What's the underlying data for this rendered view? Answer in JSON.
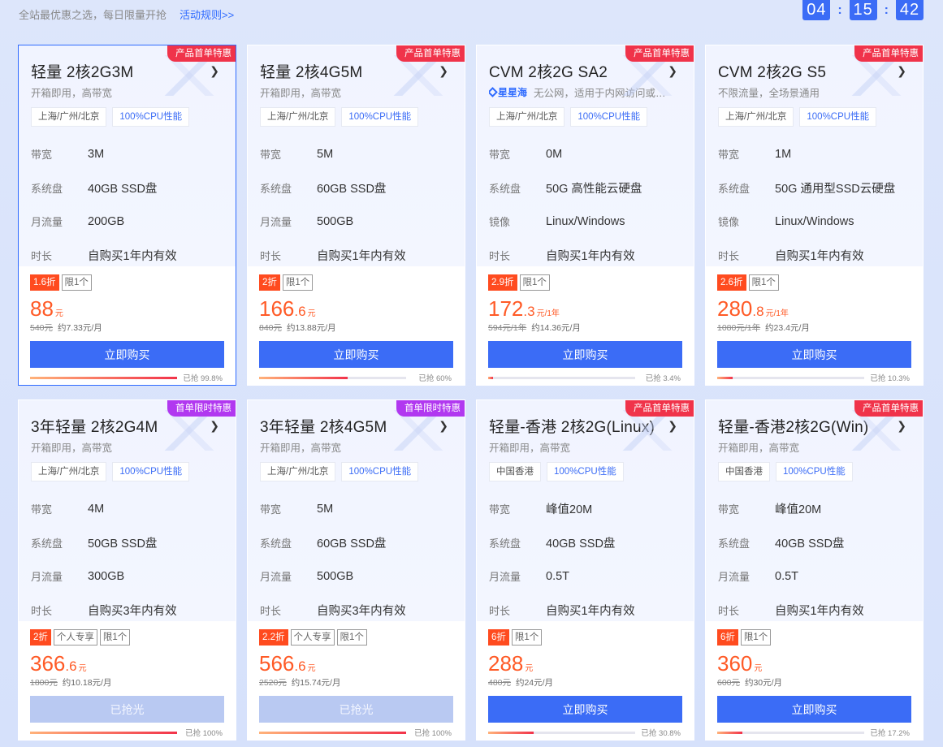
{
  "header": {
    "slogan": "全站最优惠之选，每日限量开抢",
    "rules_link": "活动规则>>",
    "countdown": [
      "04",
      "15",
      "42"
    ],
    "separator": ":"
  },
  "colors": {
    "accent": "#3b6cf6",
    "price": "#ff5a26",
    "ribbon_red": "#f0334a",
    "ribbon_purple": "#b138f0"
  },
  "cards": [
    {
      "ribbon": "产品首单特惠",
      "ribbon_color": "red",
      "active": true,
      "title": "轻量 2核2G3M",
      "subtitle": "开箱即用，高带宽",
      "brand": "",
      "tags": [
        "上海/广州/北京",
        "100%CPU性能"
      ],
      "specs": [
        {
          "k": "带宽",
          "v": "3M"
        },
        {
          "k": "系统盘",
          "v": "40GB SSD盘"
        },
        {
          "k": "月流量",
          "v": "200GB"
        },
        {
          "k": "时长",
          "v": "自购买1年内有效"
        }
      ],
      "badges": [
        "1.6折",
        "限1个"
      ],
      "price_int": "88",
      "price_dec": "",
      "price_unit": "元",
      "orig": "540元",
      "monthly": "约7.33元/月",
      "button": "立即购买",
      "sold_out": false,
      "progress_label": "已抢 99.8%",
      "progress": 0.998
    },
    {
      "ribbon": "产品首单特惠",
      "ribbon_color": "red",
      "active": false,
      "title": "轻量 2核4G5M",
      "subtitle": "开箱即用，高带宽",
      "brand": "",
      "tags": [
        "上海/广州/北京",
        "100%CPU性能"
      ],
      "specs": [
        {
          "k": "带宽",
          "v": "5M"
        },
        {
          "k": "系统盘",
          "v": "60GB SSD盘"
        },
        {
          "k": "月流量",
          "v": "500GB"
        },
        {
          "k": "时长",
          "v": "自购买1年内有效"
        }
      ],
      "badges": [
        "2折",
        "限1个"
      ],
      "price_int": "166",
      "price_dec": ".6",
      "price_unit": "元",
      "orig": "840元",
      "monthly": "约13.88元/月",
      "button": "立即购买",
      "sold_out": false,
      "progress_label": "已抢 60%",
      "progress": 0.6
    },
    {
      "ribbon": "产品首单特惠",
      "ribbon_color": "red",
      "active": false,
      "title": "CVM 2核2G SA2",
      "subtitle": "无公网，适用于内网访问或…",
      "brand": "星星海",
      "tags": [
        "上海/广州/北京",
        "100%CPU性能"
      ],
      "specs": [
        {
          "k": "带宽",
          "v": "0M"
        },
        {
          "k": "系统盘",
          "v": "50G 高性能云硬盘"
        },
        {
          "k": "镜像",
          "v": "Linux/Windows"
        },
        {
          "k": "时长",
          "v": "自购买1年内有效"
        }
      ],
      "badges": [
        "2.9折",
        "限1个"
      ],
      "price_int": "172",
      "price_dec": ".3",
      "price_unit": "元/1年",
      "orig": "594元/1年",
      "monthly": "约14.36元/月",
      "button": "立即购买",
      "sold_out": false,
      "progress_label": "已抢 3.4%",
      "progress": 0.034
    },
    {
      "ribbon": "产品首单特惠",
      "ribbon_color": "red",
      "active": false,
      "title": "CVM 2核2G S5",
      "subtitle": "不限流量，全场景通用",
      "brand": "",
      "tags": [
        "上海/广州/北京",
        "100%CPU性能"
      ],
      "specs": [
        {
          "k": "带宽",
          "v": "1M"
        },
        {
          "k": "系统盘",
          "v": "50G 通用型SSD云硬盘"
        },
        {
          "k": "镜像",
          "v": "Linux/Windows"
        },
        {
          "k": "时长",
          "v": "自购买1年内有效"
        }
      ],
      "badges": [
        "2.6折",
        "限1个"
      ],
      "price_int": "280",
      "price_dec": ".8",
      "price_unit": "元/1年",
      "orig": "1080元/1年",
      "monthly": "约23.4元/月",
      "button": "立即购买",
      "sold_out": false,
      "progress_label": "已抢 10.3%",
      "progress": 0.103
    },
    {
      "ribbon": "首单限时特惠",
      "ribbon_color": "purple",
      "active": false,
      "title": "3年轻量 2核2G4M",
      "subtitle": "开箱即用，高带宽",
      "brand": "",
      "tags": [
        "上海/广州/北京",
        "100%CPU性能"
      ],
      "specs": [
        {
          "k": "带宽",
          "v": "4M"
        },
        {
          "k": "系统盘",
          "v": "50GB SSD盘"
        },
        {
          "k": "月流量",
          "v": "300GB"
        },
        {
          "k": "时长",
          "v": "自购买3年内有效"
        }
      ],
      "badges": [
        "2折",
        "个人专享",
        "限1个"
      ],
      "price_int": "366",
      "price_dec": ".6",
      "price_unit": "元",
      "orig": "1800元",
      "monthly": "约10.18元/月",
      "button": "已抢光",
      "sold_out": true,
      "progress_label": "已抢 100%",
      "progress": 1.0
    },
    {
      "ribbon": "首单限时特惠",
      "ribbon_color": "purple",
      "active": false,
      "title": "3年轻量 2核4G5M",
      "subtitle": "开箱即用，高带宽",
      "brand": "",
      "tags": [
        "上海/广州/北京",
        "100%CPU性能"
      ],
      "specs": [
        {
          "k": "带宽",
          "v": "5M"
        },
        {
          "k": "系统盘",
          "v": "60GB SSD盘"
        },
        {
          "k": "月流量",
          "v": "500GB"
        },
        {
          "k": "时长",
          "v": "自购买3年内有效"
        }
      ],
      "badges": [
        "2.2折",
        "个人专享",
        "限1个"
      ],
      "price_int": "566",
      "price_dec": ".6",
      "price_unit": "元",
      "orig": "2520元",
      "monthly": "约15.74元/月",
      "button": "已抢光",
      "sold_out": true,
      "progress_label": "已抢 100%",
      "progress": 1.0
    },
    {
      "ribbon": "产品首单特惠",
      "ribbon_color": "red",
      "active": false,
      "title": "轻量-香港 2核2G(Linux)",
      "subtitle": "开箱即用，高带宽",
      "brand": "",
      "tags": [
        "中国香港",
        "100%CPU性能"
      ],
      "specs": [
        {
          "k": "带宽",
          "v": "峰值20M"
        },
        {
          "k": "系统盘",
          "v": "40GB SSD盘"
        },
        {
          "k": "月流量",
          "v": "0.5T"
        },
        {
          "k": "时长",
          "v": "自购买1年内有效"
        }
      ],
      "badges": [
        "6折",
        "限1个"
      ],
      "price_int": "288",
      "price_dec": "",
      "price_unit": "元",
      "orig": "480元",
      "monthly": "约24元/月",
      "button": "立即购买",
      "sold_out": false,
      "progress_label": "已抢 30.8%",
      "progress": 0.308
    },
    {
      "ribbon": "产品首单特惠",
      "ribbon_color": "red",
      "active": false,
      "title": "轻量-香港2核2G(Win)",
      "subtitle": "开箱即用，高带宽",
      "brand": "",
      "tags": [
        "中国香港",
        "100%CPU性能"
      ],
      "specs": [
        {
          "k": "带宽",
          "v": "峰值20M"
        },
        {
          "k": "系统盘",
          "v": "40GB SSD盘"
        },
        {
          "k": "月流量",
          "v": "0.5T"
        },
        {
          "k": "时长",
          "v": "自购买1年内有效"
        }
      ],
      "badges": [
        "6折",
        "限1个"
      ],
      "price_int": "360",
      "price_dec": "",
      "price_unit": "元",
      "orig": "600元",
      "monthly": "约30元/月",
      "button": "立即购买",
      "sold_out": false,
      "progress_label": "已抢 17.2%",
      "progress": 0.172
    }
  ]
}
